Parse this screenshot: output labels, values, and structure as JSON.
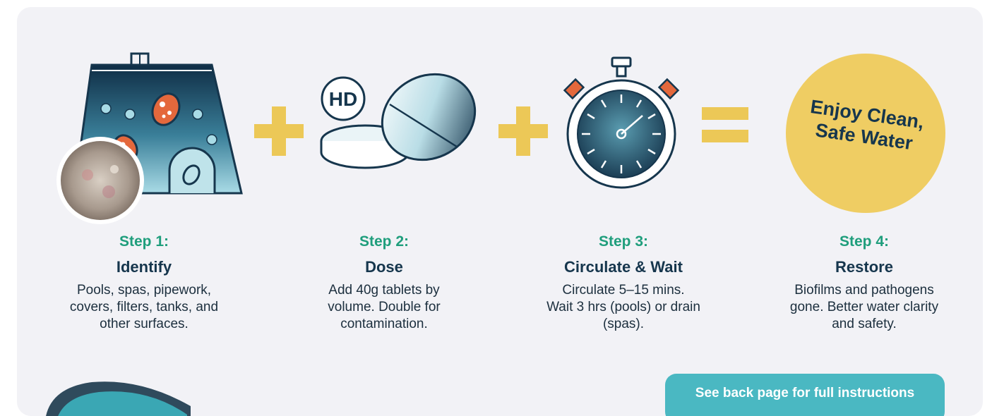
{
  "steps": [
    {
      "number": "Step 1:",
      "title": "Identify",
      "description_lines": [
        "Pools, spas, pipework,",
        "covers, filters, tanks, and",
        "other surfaces."
      ]
    },
    {
      "number": "Step 2:",
      "title": "Dose",
      "description_lines": [
        "Add 40g tablets by",
        "volume. Double for",
        "contamination."
      ]
    },
    {
      "number": "Step 3:",
      "title": "Circulate & Wait",
      "description_lines": [
        "Circulate 5–15 mins.",
        "Wait 3 hrs (pools) or drain",
        "(spas)."
      ]
    },
    {
      "number": "Step 4:",
      "title": "Restore",
      "description_lines": [
        "Biofilms and pathogens",
        "gone. Better water clarity",
        "and safety."
      ]
    }
  ],
  "badge": {
    "line1": "Enjoy Clean,",
    "line2": "Safe Water"
  },
  "tablet_logo": "HD",
  "cta": {
    "label": "See back page for full instructions"
  },
  "colors": {
    "background": "#f2f2f6",
    "step_number": "#1f9e7c",
    "title": "#16364d",
    "operator": "#ecc857",
    "badge": "#efcd63",
    "cta": "#4ab8c2",
    "bacteria": "#e4683c"
  },
  "icons": [
    "pool-bacteria-icon",
    "tablet-icon",
    "stopwatch-icon",
    "plus-icon",
    "equals-icon"
  ]
}
